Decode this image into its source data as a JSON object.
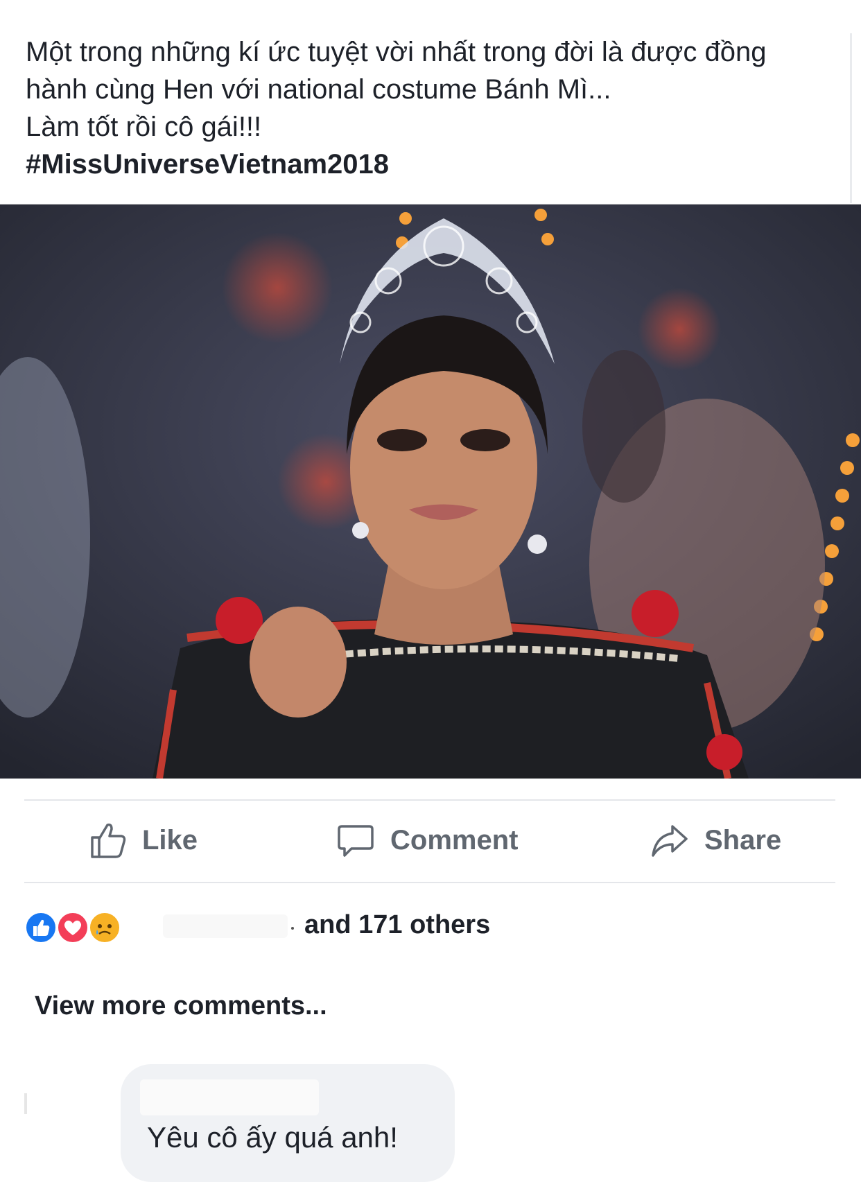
{
  "post": {
    "lines": [
      "Một trong những kí ức tuyệt vời nhất trong đời là được đồng",
      "hành cùng Hen với national costume Bánh Mì...",
      "Làm tốt rồi cô gái!!!"
    ],
    "hashtag": "#MissUniverseVietnam2018"
  },
  "photo": {
    "description_icon": "photo"
  },
  "actions": {
    "like": "Like",
    "comment": "Comment",
    "share": "Share"
  },
  "reactions": {
    "icons": [
      "like-icon",
      "love-icon",
      "sad-icon"
    ],
    "summary": "and 171 others"
  },
  "comments": {
    "view_more": "View more comments...",
    "items": [
      {
        "text": "Yêu cô ấy quá anh!"
      }
    ]
  },
  "colors": {
    "action_text": "#606770",
    "like_blue": "#1877f2",
    "love_red": "#f33e58",
    "sad_yellow": "#f7b125",
    "bubble_bg": "#f0f2f5"
  }
}
